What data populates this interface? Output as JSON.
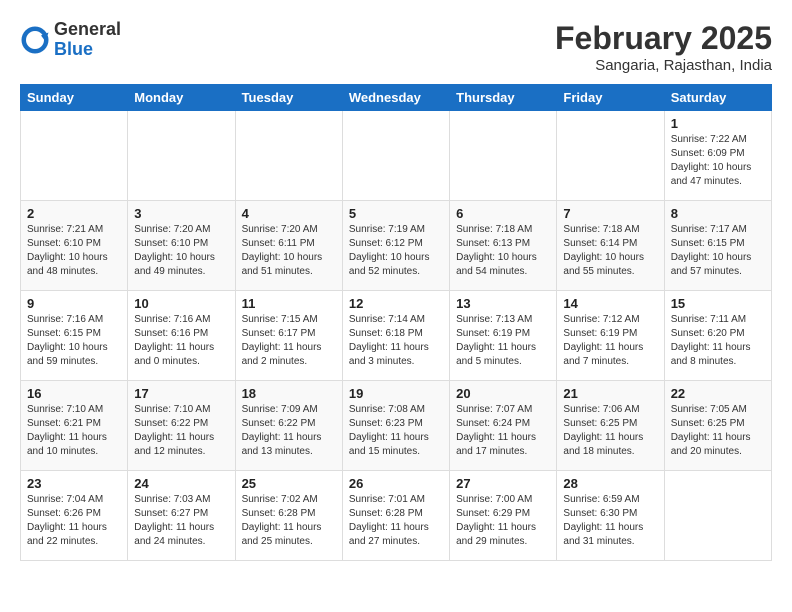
{
  "header": {
    "logo_general": "General",
    "logo_blue": "Blue",
    "title": "February 2025",
    "subtitle": "Sangaria, Rajasthan, India"
  },
  "days_of_week": [
    "Sunday",
    "Monday",
    "Tuesday",
    "Wednesday",
    "Thursday",
    "Friday",
    "Saturday"
  ],
  "weeks": [
    [
      {
        "day": "",
        "info": ""
      },
      {
        "day": "",
        "info": ""
      },
      {
        "day": "",
        "info": ""
      },
      {
        "day": "",
        "info": ""
      },
      {
        "day": "",
        "info": ""
      },
      {
        "day": "",
        "info": ""
      },
      {
        "day": "1",
        "info": "Sunrise: 7:22 AM\nSunset: 6:09 PM\nDaylight: 10 hours\nand 47 minutes."
      }
    ],
    [
      {
        "day": "2",
        "info": "Sunrise: 7:21 AM\nSunset: 6:10 PM\nDaylight: 10 hours\nand 48 minutes."
      },
      {
        "day": "3",
        "info": "Sunrise: 7:20 AM\nSunset: 6:10 PM\nDaylight: 10 hours\nand 49 minutes."
      },
      {
        "day": "4",
        "info": "Sunrise: 7:20 AM\nSunset: 6:11 PM\nDaylight: 10 hours\nand 51 minutes."
      },
      {
        "day": "5",
        "info": "Sunrise: 7:19 AM\nSunset: 6:12 PM\nDaylight: 10 hours\nand 52 minutes."
      },
      {
        "day": "6",
        "info": "Sunrise: 7:18 AM\nSunset: 6:13 PM\nDaylight: 10 hours\nand 54 minutes."
      },
      {
        "day": "7",
        "info": "Sunrise: 7:18 AM\nSunset: 6:14 PM\nDaylight: 10 hours\nand 55 minutes."
      },
      {
        "day": "8",
        "info": "Sunrise: 7:17 AM\nSunset: 6:15 PM\nDaylight: 10 hours\nand 57 minutes."
      }
    ],
    [
      {
        "day": "9",
        "info": "Sunrise: 7:16 AM\nSunset: 6:15 PM\nDaylight: 10 hours\nand 59 minutes."
      },
      {
        "day": "10",
        "info": "Sunrise: 7:16 AM\nSunset: 6:16 PM\nDaylight: 11 hours\nand 0 minutes."
      },
      {
        "day": "11",
        "info": "Sunrise: 7:15 AM\nSunset: 6:17 PM\nDaylight: 11 hours\nand 2 minutes."
      },
      {
        "day": "12",
        "info": "Sunrise: 7:14 AM\nSunset: 6:18 PM\nDaylight: 11 hours\nand 3 minutes."
      },
      {
        "day": "13",
        "info": "Sunrise: 7:13 AM\nSunset: 6:19 PM\nDaylight: 11 hours\nand 5 minutes."
      },
      {
        "day": "14",
        "info": "Sunrise: 7:12 AM\nSunset: 6:19 PM\nDaylight: 11 hours\nand 7 minutes."
      },
      {
        "day": "15",
        "info": "Sunrise: 7:11 AM\nSunset: 6:20 PM\nDaylight: 11 hours\nand 8 minutes."
      }
    ],
    [
      {
        "day": "16",
        "info": "Sunrise: 7:10 AM\nSunset: 6:21 PM\nDaylight: 11 hours\nand 10 minutes."
      },
      {
        "day": "17",
        "info": "Sunrise: 7:10 AM\nSunset: 6:22 PM\nDaylight: 11 hours\nand 12 minutes."
      },
      {
        "day": "18",
        "info": "Sunrise: 7:09 AM\nSunset: 6:22 PM\nDaylight: 11 hours\nand 13 minutes."
      },
      {
        "day": "19",
        "info": "Sunrise: 7:08 AM\nSunset: 6:23 PM\nDaylight: 11 hours\nand 15 minutes."
      },
      {
        "day": "20",
        "info": "Sunrise: 7:07 AM\nSunset: 6:24 PM\nDaylight: 11 hours\nand 17 minutes."
      },
      {
        "day": "21",
        "info": "Sunrise: 7:06 AM\nSunset: 6:25 PM\nDaylight: 11 hours\nand 18 minutes."
      },
      {
        "day": "22",
        "info": "Sunrise: 7:05 AM\nSunset: 6:25 PM\nDaylight: 11 hours\nand 20 minutes."
      }
    ],
    [
      {
        "day": "23",
        "info": "Sunrise: 7:04 AM\nSunset: 6:26 PM\nDaylight: 11 hours\nand 22 minutes."
      },
      {
        "day": "24",
        "info": "Sunrise: 7:03 AM\nSunset: 6:27 PM\nDaylight: 11 hours\nand 24 minutes."
      },
      {
        "day": "25",
        "info": "Sunrise: 7:02 AM\nSunset: 6:28 PM\nDaylight: 11 hours\nand 25 minutes."
      },
      {
        "day": "26",
        "info": "Sunrise: 7:01 AM\nSunset: 6:28 PM\nDaylight: 11 hours\nand 27 minutes."
      },
      {
        "day": "27",
        "info": "Sunrise: 7:00 AM\nSunset: 6:29 PM\nDaylight: 11 hours\nand 29 minutes."
      },
      {
        "day": "28",
        "info": "Sunrise: 6:59 AM\nSunset: 6:30 PM\nDaylight: 11 hours\nand 31 minutes."
      },
      {
        "day": "",
        "info": ""
      }
    ]
  ]
}
